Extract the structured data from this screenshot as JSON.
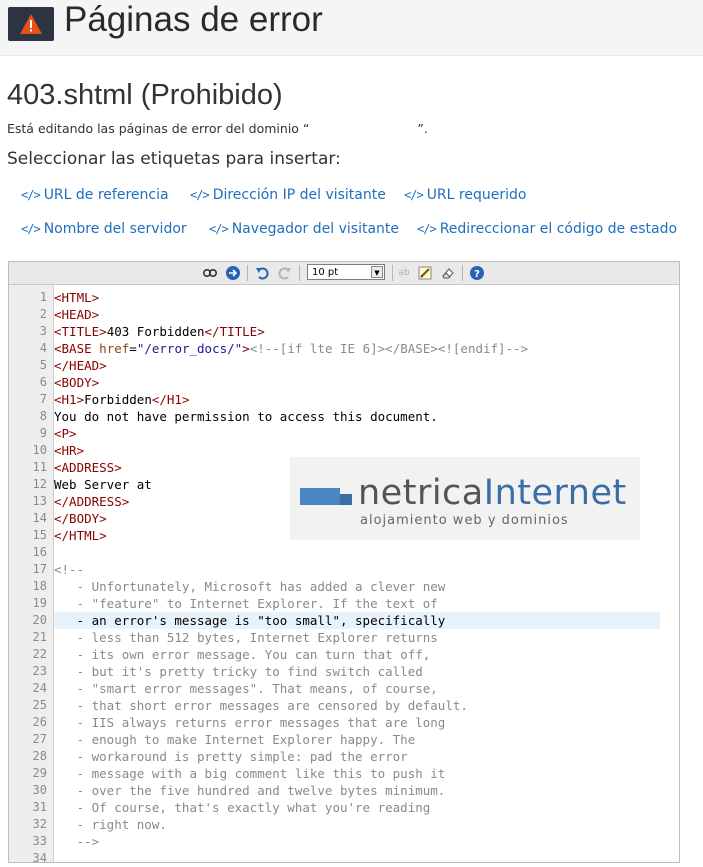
{
  "header": {
    "title": "Páginas de error",
    "icon": "warning-icon"
  },
  "file_title": "403.shtml (Prohibido)",
  "domain_line": {
    "prefix": "Está editando las páginas de error del dominio “",
    "suffix": "”."
  },
  "tags_label": "Seleccionar las etiquetas para insertar:",
  "tags": [
    {
      "label": "URL de referencia"
    },
    {
      "label": "Dirección IP del visitante"
    },
    {
      "label": "URL requerido"
    },
    {
      "label": "Nombre del servidor"
    },
    {
      "label": "Navegador del visitante"
    },
    {
      "label": "Redireccionar el código de estado"
    }
  ],
  "toolbar": {
    "font_size": "10 pt"
  },
  "code_lines": [
    {
      "n": "1",
      "kind": "markup",
      "html": "<span class=\"t\">&lt;HTML&gt;</span>"
    },
    {
      "n": "2",
      "kind": "markup",
      "html": "<span class=\"t\">&lt;HEAD&gt;</span>"
    },
    {
      "n": "3",
      "kind": "markup",
      "html": "<span class=\"t\">&lt;TITLE&gt;</span>403 Forbidden<span class=\"t\">&lt;/TITLE&gt;</span>"
    },
    {
      "n": "4",
      "kind": "markup",
      "html": "<span class=\"t\">&lt;BASE</span> <span class=\"a\">href</span>=<span class=\"s\">\"/error_docs/\"</span><span class=\"t\">&gt;</span><span class=\"c\">&lt;!--[if lte IE 6]&gt;&lt;/BASE&gt;&lt;![endif]--&gt;</span>"
    },
    {
      "n": "5",
      "kind": "markup",
      "html": "<span class=\"t\">&lt;/HEAD&gt;</span>"
    },
    {
      "n": "6",
      "kind": "markup",
      "html": "<span class=\"t\">&lt;BODY&gt;</span>"
    },
    {
      "n": "7",
      "kind": "markup",
      "html": "<span class=\"t\">&lt;H1&gt;</span>Forbidden<span class=\"t\">&lt;/H1&gt;</span>"
    },
    {
      "n": "8",
      "kind": "markup",
      "html": "You do not have permission to access this document."
    },
    {
      "n": "9",
      "kind": "markup",
      "html": "<span class=\"t\">&lt;P&gt;</span>"
    },
    {
      "n": "10",
      "kind": "markup",
      "html": "<span class=\"t\">&lt;HR&gt;</span>"
    },
    {
      "n": "11",
      "kind": "markup",
      "html": "<span class=\"t\">&lt;ADDRESS&gt;</span>"
    },
    {
      "n": "12",
      "kind": "markup",
      "html": "Web Server at"
    },
    {
      "n": "13",
      "kind": "markup",
      "html": "<span class=\"t\">&lt;/ADDRESS&gt;</span>"
    },
    {
      "n": "14",
      "kind": "markup",
      "html": "<span class=\"t\">&lt;/BODY&gt;</span>"
    },
    {
      "n": "15",
      "kind": "markup",
      "html": "<span class=\"t\">&lt;/HTML&gt;</span>"
    },
    {
      "n": "16",
      "kind": "markup",
      "html": ""
    },
    {
      "n": "17",
      "kind": "comment",
      "text": "<!--"
    },
    {
      "n": "18",
      "kind": "comment",
      "text": "   - Unfortunately, Microsoft has added a clever new"
    },
    {
      "n": "19",
      "kind": "comment",
      "text": "   - \"feature\" to Internet Explorer. If the text of"
    },
    {
      "n": "20",
      "kind": "comment",
      "text": "   - an error's message is \"too small\", specifically",
      "highlight": true
    },
    {
      "n": "21",
      "kind": "comment",
      "text": "   - less than 512 bytes, Internet Explorer returns"
    },
    {
      "n": "22",
      "kind": "comment",
      "text": "   - its own error message. You can turn that off,"
    },
    {
      "n": "23",
      "kind": "comment",
      "text": "   - but it's pretty tricky to find switch called"
    },
    {
      "n": "24",
      "kind": "comment",
      "text": "   - \"smart error messages\". That means, of course,"
    },
    {
      "n": "25",
      "kind": "comment",
      "text": "   - that short error messages are censored by default."
    },
    {
      "n": "26",
      "kind": "comment",
      "text": "   - IIS always returns error messages that are long"
    },
    {
      "n": "27",
      "kind": "comment",
      "text": "   - enough to make Internet Explorer happy. The"
    },
    {
      "n": "28",
      "kind": "comment",
      "text": "   - workaround is pretty simple: pad the error"
    },
    {
      "n": "29",
      "kind": "comment",
      "text": "   - message with a big comment like this to push it"
    },
    {
      "n": "30",
      "kind": "comment",
      "text": "   - over the five hundred and twelve bytes minimum."
    },
    {
      "n": "31",
      "kind": "comment",
      "text": "   - Of course, that's exactly what you're reading"
    },
    {
      "n": "32",
      "kind": "comment",
      "text": "   - right now."
    },
    {
      "n": "33",
      "kind": "comment",
      "text": "   -->"
    },
    {
      "n": "34",
      "kind": "comment",
      "text": ""
    }
  ],
  "logo": {
    "word_a": "netrica",
    "word_b": "Internet",
    "tagline": "alojamiento web y dominios"
  },
  "colors": {
    "link": "#1f6fbf",
    "tag": "#8b0000",
    "highlight": "#e8f2fb",
    "logo_blue": "#3a6ea5"
  }
}
